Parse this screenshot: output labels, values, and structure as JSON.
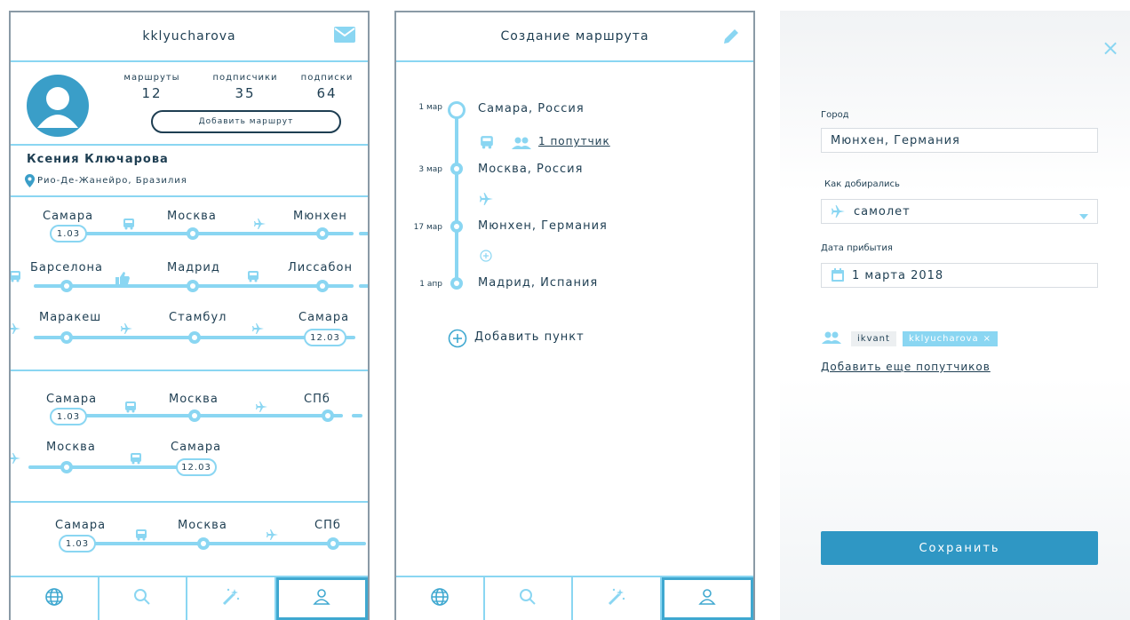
{
  "profile": {
    "header": {
      "username": "kklyucharova",
      "icon": "mail-icon"
    },
    "stats": [
      {
        "label": "маршруты",
        "value": "12"
      },
      {
        "label": "подписчики",
        "value": "35"
      },
      {
        "label": "подписки",
        "value": "64"
      }
    ],
    "add_route_label": "Добавить маршрут",
    "name": "Ксения Ключарова",
    "location": "Рио-Де-Жанейро, Бразилия",
    "routes": [
      {
        "cities": [
          "Самара",
          "Москва",
          "Мюнхен"
        ],
        "dates": [
          "1.03"
        ]
      },
      {
        "cities": [
          "Барселона",
          "Мадрид",
          "Лиссабон"
        ],
        "dates": []
      },
      {
        "cities": [
          "Маракеш",
          "Стамбул",
          "Самара"
        ],
        "dates": [
          "12.03"
        ]
      },
      {
        "cities": [
          "Самара",
          "Москва",
          "СПб"
        ],
        "dates": [
          "1.03"
        ]
      },
      {
        "cities": [
          "Москва",
          "Самара"
        ],
        "dates": [
          "12.03"
        ]
      },
      {
        "cities": [
          "Самара",
          "Москва",
          "СПб"
        ],
        "dates": [
          "1.03"
        ]
      }
    ]
  },
  "route_editor": {
    "title": "Создание маршрута",
    "stops": [
      {
        "date": "1 мар",
        "city": "Самара, Россия"
      },
      {
        "date": "3 мар",
        "city": "Москва, Россия"
      },
      {
        "date": "17 мар",
        "city": "Мюнхен, Германия"
      },
      {
        "date": "1 апр",
        "city": "Мадрид, Испания"
      }
    ],
    "companion_link": "1 попутчик",
    "add_stop_label": "Добавить пункт"
  },
  "stop_form": {
    "city_label": "Город",
    "city_value": "Мюнхен, Германия",
    "transport_label": "Как добирались",
    "transport_value": "самолет",
    "arrival_label": "Дата прибытия",
    "arrival_value": "1 марта 2018",
    "companions": [
      "ikvant",
      "kklyucharova"
    ],
    "tag_remove": "×",
    "add_companions_label": "Добавить еще попутчиков",
    "save_label": "Сохранить",
    "close": "×"
  },
  "colors": {
    "accent": "#8ad6f2",
    "primary": "#2f97c4",
    "text": "#1e3e52",
    "avatar": "#3a9ec8"
  }
}
